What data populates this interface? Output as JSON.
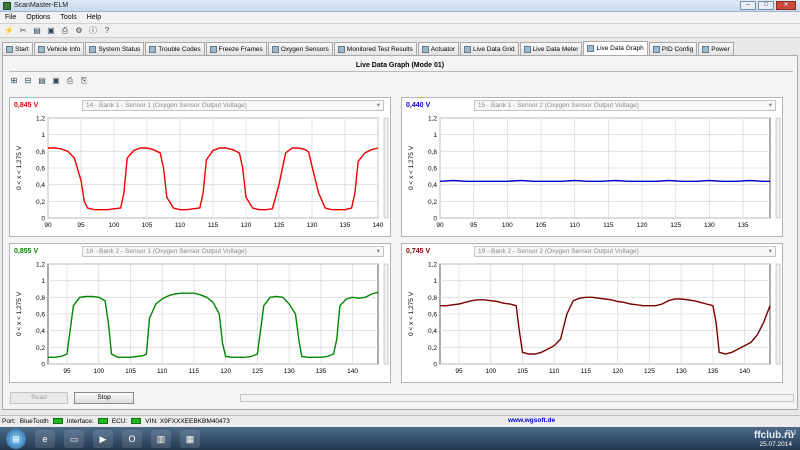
{
  "window": {
    "title": "ScanMaster-ELM"
  },
  "menu": [
    "File",
    "Options",
    "Tools",
    "Help"
  ],
  "tabs": [
    {
      "label": "Start"
    },
    {
      "label": "Vehicle Info"
    },
    {
      "label": "System Status"
    },
    {
      "label": "Trouble Codes"
    },
    {
      "label": "Freeze Frames"
    },
    {
      "label": "Oxygen Sensors"
    },
    {
      "label": "Monitored Test Results"
    },
    {
      "label": "Actuator"
    },
    {
      "label": "Live Data Grid"
    },
    {
      "label": "Live Data Meter"
    },
    {
      "label": "Live Data Graph"
    },
    {
      "label": "PID Config"
    },
    {
      "label": "Power"
    }
  ],
  "graph_title": "Live Data Graph (Mode 01)",
  "panels": [
    {
      "value": "0,845 V",
      "value_color": "#dd0000",
      "sensor": "14 - Bank 1 - Sensor 1 (Oxygen Sensor Output Voltage)",
      "ylabel": "0  <  x  <  1,275 V"
    },
    {
      "value": "0,440 V",
      "value_color": "#0000cc",
      "sensor": "15 - Bank 1 - Sensor 2 (Oxygen Sensor Output Voltage)",
      "ylabel": "0  <  x  <  1,275 V"
    },
    {
      "value": "0,855 V",
      "value_color": "#008800",
      "sensor": "18 - Bank 2 - Sensor 1 (Oxygen Sensor Output Voltage)",
      "ylabel": "0  <  x  <  1,275 V"
    },
    {
      "value": "0,745 V",
      "value_color": "#7a0000",
      "sensor": "19 - Bank 2 - Sensor 2 (Oxygen Sensor Output Voltage)",
      "ylabel": "0  <  x  <  1,275 V"
    }
  ],
  "buttons": {
    "read": "Read",
    "stop": "Stop"
  },
  "status": {
    "port_label": "Port:",
    "port_value": "BlueTooth",
    "interface_label": "Interface:",
    "ecu_label": "ECU:",
    "vin": "VIN: X9FXXXEEBKBM40473",
    "site": "www.wgsoft.de"
  },
  "tray": {
    "lang": "RU",
    "date": "25.07.2014",
    "watermark": "ffclub.ru"
  },
  "chart_data": [
    {
      "type": "line",
      "title": "",
      "xlabel": "",
      "ylabel": "0  <  x  <  1,275 V",
      "xlim": [
        90,
        140
      ],
      "ylim": [
        0,
        1.2
      ],
      "xticks": [
        90,
        95,
        100,
        105,
        110,
        115,
        120,
        125,
        130,
        135,
        140
      ],
      "yticks": [
        0,
        0.2,
        0.4,
        0.6,
        0.8,
        1,
        1.2
      ],
      "ytick_labels": [
        "0",
        "0,2",
        "0,4",
        "0,6",
        "0,8",
        "1",
        "1,2"
      ],
      "series": [
        {
          "color": "#ee0000",
          "x": [
            90,
            91,
            92,
            93,
            94,
            95,
            95.5,
            96,
            97,
            98,
            99,
            100,
            101,
            101.5,
            102,
            103,
            104,
            105,
            106,
            107,
            107.5,
            108,
            109,
            110,
            111,
            112,
            113,
            113.5,
            114,
            115,
            116,
            117,
            118,
            119,
            119.5,
            120,
            121,
            122,
            123,
            124,
            125,
            126,
            127,
            128,
            129,
            129.5,
            130,
            131,
            132,
            133,
            134,
            135,
            136,
            136.5,
            137,
            138,
            139,
            140
          ],
          "y": [
            0.84,
            0.84,
            0.83,
            0.8,
            0.72,
            0.45,
            0.2,
            0.12,
            0.1,
            0.1,
            0.1,
            0.11,
            0.12,
            0.3,
            0.72,
            0.81,
            0.84,
            0.84,
            0.82,
            0.78,
            0.6,
            0.25,
            0.12,
            0.1,
            0.1,
            0.11,
            0.12,
            0.3,
            0.7,
            0.81,
            0.84,
            0.84,
            0.82,
            0.78,
            0.6,
            0.25,
            0.12,
            0.1,
            0.1,
            0.11,
            0.4,
            0.78,
            0.84,
            0.84,
            0.82,
            0.79,
            0.62,
            0.3,
            0.12,
            0.1,
            0.1,
            0.1,
            0.12,
            0.3,
            0.68,
            0.78,
            0.82,
            0.84
          ]
        }
      ]
    },
    {
      "type": "line",
      "title": "",
      "xlabel": "",
      "ylabel": "0  <  x  <  1,275 V",
      "xlim": [
        90,
        139
      ],
      "ylim": [
        0,
        1.2
      ],
      "xticks": [
        90,
        95,
        100,
        105,
        110,
        115,
        120,
        125,
        130,
        135
      ],
      "yticks": [
        0,
        0.2,
        0.4,
        0.6,
        0.8,
        1,
        1.2
      ],
      "ytick_labels": [
        "0",
        "0,2",
        "0,4",
        "0,6",
        "0,8",
        "1",
        "1,2"
      ],
      "series": [
        {
          "color": "#0000cc",
          "x": [
            90,
            92,
            94,
            96,
            98,
            100,
            102,
            104,
            106,
            108,
            110,
            112,
            114,
            116,
            118,
            120,
            122,
            124,
            126,
            128,
            130,
            132,
            134,
            136,
            138,
            139
          ],
          "y": [
            0.44,
            0.45,
            0.44,
            0.44,
            0.44,
            0.44,
            0.45,
            0.44,
            0.44,
            0.44,
            0.45,
            0.44,
            0.44,
            0.45,
            0.44,
            0.44,
            0.44,
            0.45,
            0.44,
            0.44,
            0.45,
            0.44,
            0.44,
            0.45,
            0.44,
            0.44
          ]
        }
      ]
    },
    {
      "type": "line",
      "title": "",
      "xlabel": "",
      "ylabel": "0  <  x  <  1,275 V",
      "xlim": [
        92,
        144
      ],
      "ylim": [
        0,
        1.2
      ],
      "xticks": [
        95,
        100,
        105,
        110,
        115,
        120,
        125,
        130,
        135,
        140
      ],
      "yticks": [
        0,
        0.2,
        0.4,
        0.6,
        0.8,
        1,
        1.2
      ],
      "ytick_labels": [
        "0",
        "0,2",
        "0,4",
        "0,6",
        "0,8",
        "1",
        "1,2"
      ],
      "series": [
        {
          "color": "#008800",
          "x": [
            92,
            93,
            94,
            95,
            96,
            97,
            98,
            99,
            100,
            101,
            101.5,
            102,
            103,
            104,
            105,
            106,
            107,
            107.5,
            108,
            109,
            110,
            111,
            112,
            113,
            114,
            115,
            116,
            117,
            118,
            119,
            119.5,
            120,
            121,
            122,
            123,
            124,
            125,
            126,
            127,
            128,
            129,
            130,
            131,
            131.5,
            132,
            133,
            134,
            135,
            136,
            137,
            137.5,
            138,
            139,
            140,
            141,
            142,
            143,
            144
          ],
          "y": [
            0.08,
            0.08,
            0.09,
            0.12,
            0.7,
            0.8,
            0.81,
            0.81,
            0.8,
            0.76,
            0.5,
            0.12,
            0.08,
            0.08,
            0.08,
            0.09,
            0.1,
            0.12,
            0.55,
            0.72,
            0.78,
            0.82,
            0.84,
            0.85,
            0.85,
            0.85,
            0.83,
            0.8,
            0.74,
            0.6,
            0.25,
            0.09,
            0.08,
            0.08,
            0.08,
            0.09,
            0.12,
            0.7,
            0.8,
            0.81,
            0.8,
            0.72,
            0.6,
            0.3,
            0.09,
            0.08,
            0.08,
            0.08,
            0.09,
            0.12,
            0.3,
            0.7,
            0.78,
            0.8,
            0.79,
            0.8,
            0.84,
            0.86
          ]
        }
      ]
    },
    {
      "type": "line",
      "title": "",
      "xlabel": "",
      "ylabel": "0  <  x  <  1,275 V",
      "xlim": [
        92,
        144
      ],
      "ylim": [
        0,
        1.2
      ],
      "xticks": [
        95,
        100,
        105,
        110,
        115,
        120,
        125,
        130,
        135,
        140
      ],
      "yticks": [
        0,
        0.2,
        0.4,
        0.6,
        0.8,
        1,
        1.2
      ],
      "ytick_labels": [
        "0",
        "0,2",
        "0,4",
        "0,6",
        "0,8",
        "1",
        "1,2"
      ],
      "series": [
        {
          "color": "#7a0000",
          "x": [
            92,
            93,
            94,
            95,
            96,
            97,
            98,
            99,
            100,
            101,
            102,
            103,
            104,
            104.5,
            105,
            106,
            107,
            108,
            109,
            110,
            111,
            112,
            113,
            114,
            115,
            116,
            117,
            118,
            119,
            120,
            121,
            122,
            123,
            124,
            125,
            126,
            127,
            128,
            129,
            130,
            131,
            132,
            133,
            134,
            135,
            135.5,
            136,
            137,
            138,
            139,
            140,
            141,
            142,
            143,
            144
          ],
          "y": [
            0.7,
            0.7,
            0.71,
            0.72,
            0.74,
            0.76,
            0.77,
            0.77,
            0.76,
            0.75,
            0.73,
            0.72,
            0.7,
            0.4,
            0.14,
            0.12,
            0.12,
            0.14,
            0.18,
            0.22,
            0.3,
            0.6,
            0.76,
            0.79,
            0.8,
            0.8,
            0.79,
            0.78,
            0.77,
            0.75,
            0.74,
            0.72,
            0.71,
            0.7,
            0.7,
            0.7,
            0.72,
            0.76,
            0.78,
            0.78,
            0.77,
            0.76,
            0.74,
            0.72,
            0.7,
            0.5,
            0.14,
            0.12,
            0.14,
            0.18,
            0.22,
            0.26,
            0.35,
            0.5,
            0.7
          ]
        }
      ]
    }
  ]
}
